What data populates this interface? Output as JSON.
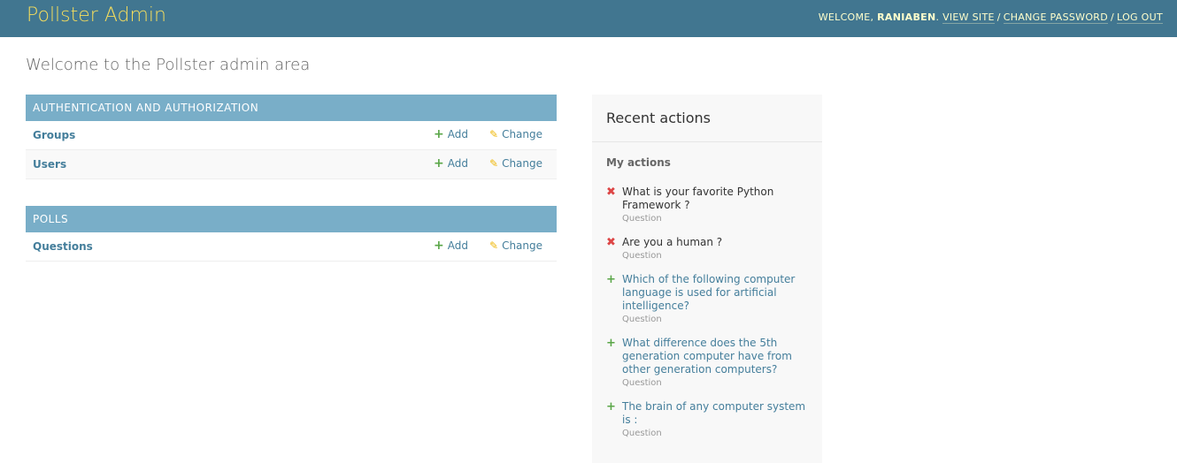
{
  "header": {
    "brand": "Pollster Admin",
    "welcome": "WELCOME,",
    "username": "RANIABEN",
    "view_site": "VIEW SITE",
    "change_password": "CHANGE PASSWORD",
    "log_out": "LOG OUT",
    "separator": "/"
  },
  "page_title": "Welcome to the Pollster admin area",
  "modules": [
    {
      "caption": "AUTHENTICATION AND AUTHORIZATION",
      "rows": [
        {
          "name": "Groups",
          "add": "Add",
          "change": "Change"
        },
        {
          "name": "Users",
          "add": "Add",
          "change": "Change"
        }
      ]
    },
    {
      "caption": "POLLS",
      "rows": [
        {
          "name": "Questions",
          "add": "Add",
          "change": "Change"
        }
      ]
    }
  ],
  "recent_actions": {
    "title": "Recent actions",
    "subtitle": "My actions",
    "items": [
      {
        "kind": "deletion",
        "text": "What is your favorite Python Framework ?",
        "type": "Question"
      },
      {
        "kind": "deletion",
        "text": "Are you a human ?",
        "type": "Question"
      },
      {
        "kind": "addition",
        "text": "Which of the following computer language is used for artificial intelligence?",
        "type": "Question"
      },
      {
        "kind": "addition",
        "text": "What difference does the 5th generation computer have from other generation computers?",
        "type": "Question"
      },
      {
        "kind": "addition",
        "text": "The brain of any computer system is :",
        "type": "Question"
      }
    ]
  },
  "colors": {
    "header_bg": "#417690",
    "brand": "#f5dd5d",
    "module_caption_bg": "#79aec8",
    "link": "#447e9b",
    "add_icon": "#5aa648",
    "change_icon": "#efb80b",
    "delete_icon": "#dd4646"
  },
  "icons": {
    "add": "plus-icon",
    "change": "pencil-icon",
    "deletion": "cross-icon"
  }
}
